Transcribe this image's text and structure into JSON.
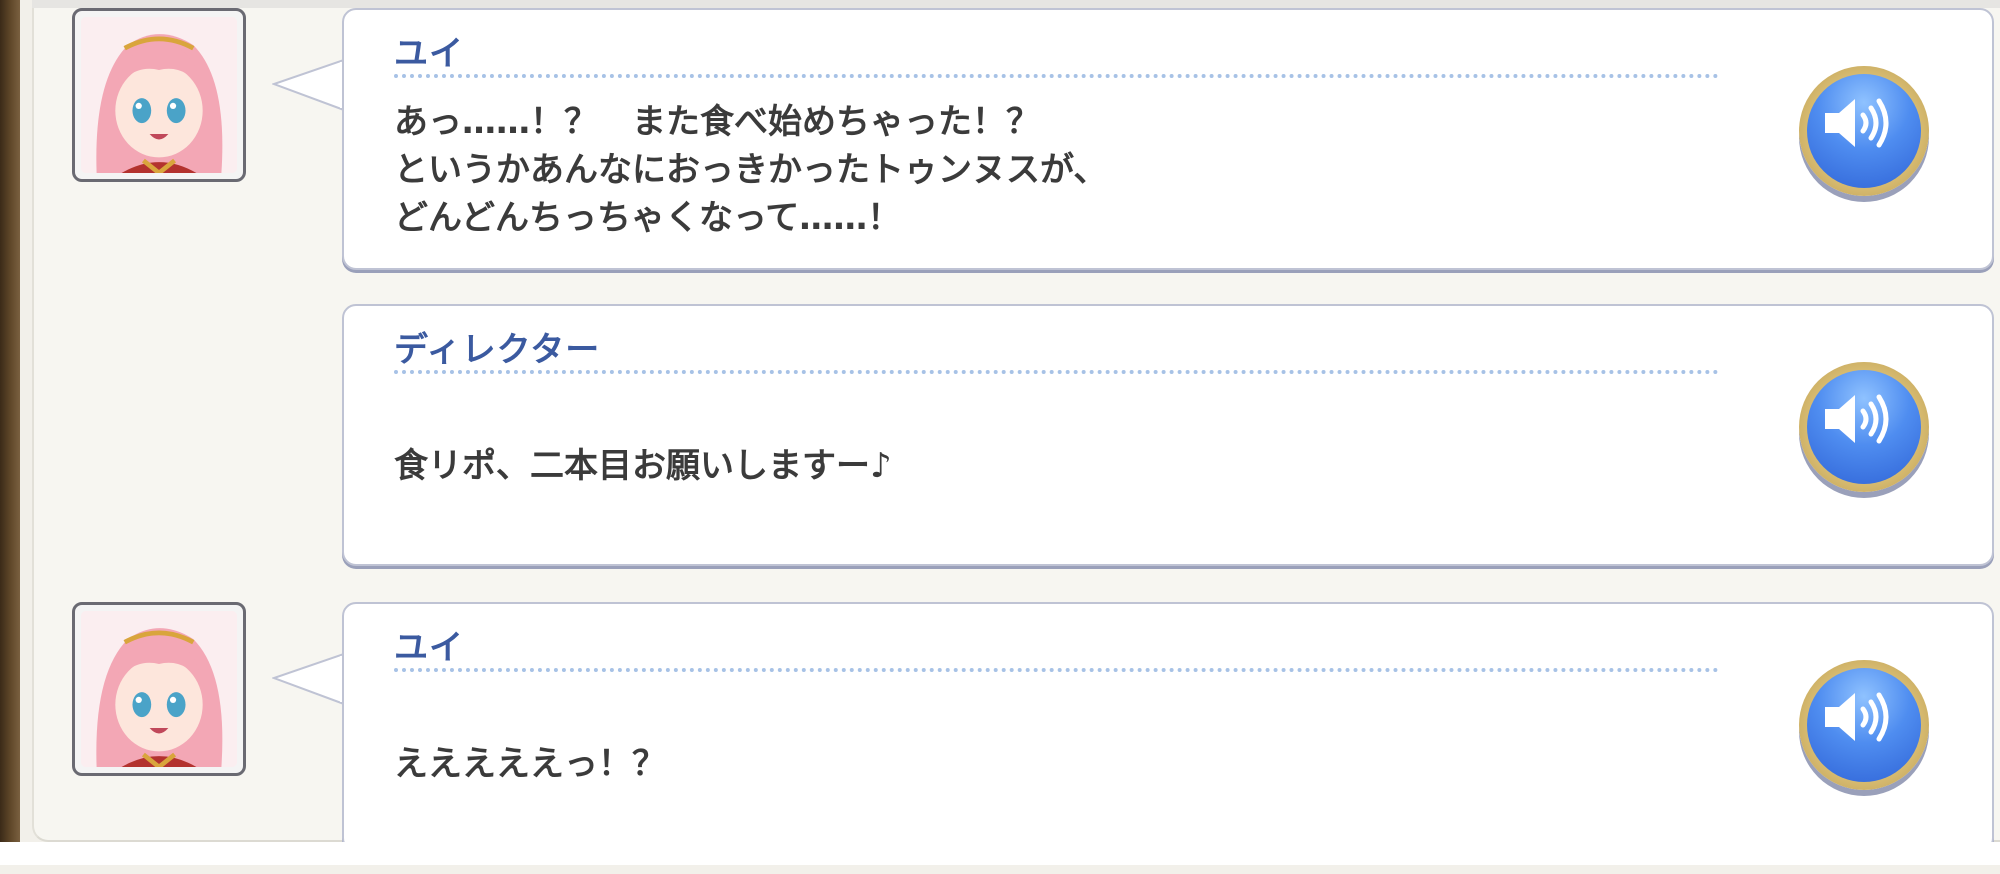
{
  "log": {
    "entries": [
      {
        "speaker": "ユイ",
        "has_avatar": true,
        "lines": [
          "あっ……！？　また食べ始めちゃった！？",
          "というかあんなにおっきかったトゥンヌスが、",
          "どんどんちっちゃくなって……！"
        ]
      },
      {
        "speaker": "ディレクター",
        "has_avatar": false,
        "lines": [
          "食リポ、二本目お願いしますー♪"
        ]
      },
      {
        "speaker": "ユイ",
        "has_avatar": true,
        "lines": [
          "えええええっ！？"
        ]
      }
    ]
  },
  "icons": {
    "voice": "speaker-sound-icon",
    "avatar": "character-portrait-yui"
  },
  "colors": {
    "speaker_name": "#3b5aa0",
    "dialogue_text": "#3b3b3b",
    "divider": "#a7c2e6",
    "voice_button_blue": "#4f8df0",
    "voice_button_rim": "#d8bc72",
    "panel_bg": "#f7f6f1"
  }
}
